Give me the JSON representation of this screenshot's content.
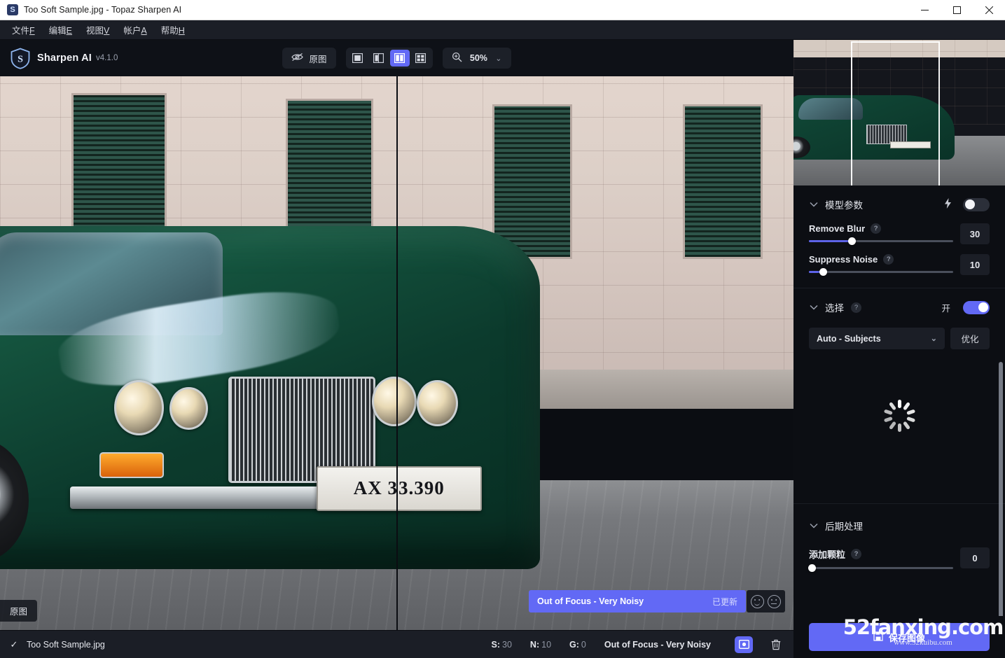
{
  "window": {
    "title": "Too Soft Sample.jpg - Topaz Sharpen AI",
    "app_icon": "topaz-shield-icon",
    "minimize": "minimize-icon",
    "maximize": "maximize-icon",
    "close": "close-icon"
  },
  "menu": [
    {
      "label": "文件",
      "accel": "F"
    },
    {
      "label": "编辑",
      "accel": "E"
    },
    {
      "label": "视图",
      "accel": "V"
    },
    {
      "label": "帐户",
      "accel": "A"
    },
    {
      "label": "帮助",
      "accel": "H"
    }
  ],
  "toolbar": {
    "brand_name": "Sharpen AI",
    "brand_version": "v4.1.0",
    "original_label": "原图",
    "original_icon": "eye-slash-icon",
    "view_modes": [
      {
        "name": "single-view",
        "icon": "single-pane-icon",
        "active": false
      },
      {
        "name": "split-view",
        "icon": "split-pane-icon",
        "active": false
      },
      {
        "name": "side-by-side-view",
        "icon": "side-by-side-icon",
        "active": true
      },
      {
        "name": "quad-view",
        "icon": "quad-pane-icon",
        "active": false
      }
    ],
    "zoom_icon": "zoom-in-icon",
    "zoom_value": "50%",
    "zoom_chevron": "chevron-down-icon"
  },
  "preview": {
    "original_badge": "原图",
    "license_plate": "AX 33.390",
    "preset_banner": {
      "name": "Out of Focus - Very Noisy",
      "state": "已更新",
      "feedback_good": "smiley-happy-icon",
      "feedback_meh": "smiley-neutral-icon"
    }
  },
  "statusbar": {
    "check_icon": "check-icon",
    "file_name": "Too Soft Sample.jpg",
    "metrics": [
      {
        "key": "S:",
        "value": "30"
      },
      {
        "key": "N:",
        "value": "10"
      },
      {
        "key": "G:",
        "value": "0"
      }
    ],
    "preset": "Out of Focus - Very Noisy",
    "preview_button_icon": "image-preview-icon",
    "delete_button_icon": "trash-icon"
  },
  "navigator": {
    "name": "navigator-thumbnail",
    "viewport_rect": "viewport-indicator"
  },
  "panel": {
    "model_section": {
      "title": "模型参数",
      "chevron": "chevron-down-icon",
      "bolt_icon": "lightning-bolt-icon",
      "auto_toggle_on": false,
      "sliders": [
        {
          "label": "Remove Blur",
          "help": "?",
          "value": "30",
          "percent": 30
        },
        {
          "label": "Suppress Noise",
          "help": "?",
          "value": "10",
          "percent": 10
        }
      ]
    },
    "selection_section": {
      "title": "选择",
      "chevron": "chevron-down-icon",
      "help": "?",
      "toggle_label": "开",
      "toggle_on": true,
      "mode_value": "Auto - Subjects",
      "mode_chevron": "chevron-down-icon",
      "refine_label": "优化",
      "loading": true
    },
    "post_section": {
      "title": "后期处理",
      "chevron": "chevron-down-icon",
      "sliders": [
        {
          "label": "添加颗粒",
          "help": "?",
          "value": "0",
          "percent": 0
        }
      ]
    },
    "save_button": {
      "label": "保存图像",
      "icon": "save-disk-icon"
    }
  },
  "watermark": {
    "main": "52fanxing.com",
    "sub": "www.52kuibu.com"
  },
  "colors": {
    "accent": "#6269f5",
    "panel_bg": "#0c0e13",
    "toolbar_bg": "#0e1117",
    "statusbar_bg": "#1b1e26"
  }
}
